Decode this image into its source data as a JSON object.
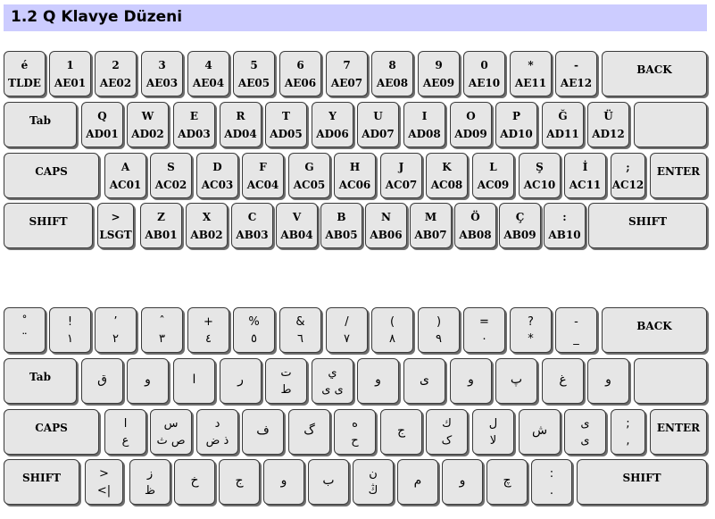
{
  "title": "1.2 Q Klavye Düzeni",
  "keyboards": [
    {
      "rows": [
        [
          [
            "é",
            "TLDE"
          ],
          [
            "1",
            "AE01"
          ],
          [
            "2",
            "AE02"
          ],
          [
            "3",
            "AE03"
          ],
          [
            "4",
            "AE04"
          ],
          [
            "5",
            "AE05"
          ],
          [
            "6",
            "AE06"
          ],
          [
            "7",
            "AE07"
          ],
          [
            "8",
            "AE08"
          ],
          [
            "9",
            "AE09"
          ],
          [
            "0",
            "AE10"
          ],
          [
            "*",
            "AE11"
          ],
          [
            "-",
            "AE12"
          ],
          [
            "BACK",
            ""
          ]
        ],
        [
          [
            "Tab",
            ""
          ],
          [
            "Q",
            "AD01"
          ],
          [
            "W",
            "AD02"
          ],
          [
            "E",
            "AD03"
          ],
          [
            "R",
            "AD04"
          ],
          [
            "T",
            "AD05"
          ],
          [
            "Y",
            "AD06"
          ],
          [
            "U",
            "AD07"
          ],
          [
            "I",
            "AD08"
          ],
          [
            "O",
            "AD09"
          ],
          [
            "P",
            "AD10"
          ],
          [
            "Ğ",
            "AD11"
          ],
          [
            "Ü",
            "AD12"
          ],
          [
            "",
            ""
          ]
        ],
        [
          [
            "CAPS",
            ""
          ],
          [
            "A",
            "AC01"
          ],
          [
            "S",
            "AC02"
          ],
          [
            "D",
            "AC03"
          ],
          [
            "F",
            "AC04"
          ],
          [
            "G",
            "AC05"
          ],
          [
            "H",
            "AC06"
          ],
          [
            "J",
            "AC07"
          ],
          [
            "K",
            "AC08"
          ],
          [
            "L",
            "AC09"
          ],
          [
            "Ş",
            "AC10"
          ],
          [
            "İ",
            "AC11"
          ],
          [
            ";",
            "AC12"
          ],
          [
            "ENTER",
            ""
          ]
        ],
        [
          [
            "SHIFT",
            ""
          ],
          [
            ">",
            "LSGT"
          ],
          [
            "Z",
            "AB01"
          ],
          [
            "X",
            "AB02"
          ],
          [
            "C",
            "AB03"
          ],
          [
            "V",
            "AB04"
          ],
          [
            "B",
            "AB05"
          ],
          [
            "N",
            "AB06"
          ],
          [
            "M",
            "AB07"
          ],
          [
            "Ö",
            "AB08"
          ],
          [
            "Ç",
            "AB09"
          ],
          [
            ":",
            "AB10"
          ],
          [
            "SHIFT",
            ""
          ]
        ]
      ]
    },
    {
      "rows": [
        [
          [
            "˚",
            "¨"
          ],
          [
            "!",
            "١"
          ],
          [
            "’",
            "٢"
          ],
          [
            "ˆ",
            "٣"
          ],
          [
            "+",
            "٤"
          ],
          [
            "%",
            "٥"
          ],
          [
            "&",
            "٦"
          ],
          [
            "/",
            "٧"
          ],
          [
            "(",
            "٨"
          ],
          [
            ")",
            "٩"
          ],
          [
            "=",
            "٠"
          ],
          [
            "?",
            "*"
          ],
          [
            "-",
            "_"
          ],
          [
            "BACK",
            ""
          ]
        ],
        [
          [
            "Tab",
            ""
          ],
          [
            "ق",
            ""
          ],
          [
            "و",
            ""
          ],
          [
            "ا",
            ""
          ],
          [
            "ر",
            ""
          ],
          [
            "ت",
            "ط"
          ],
          [
            "ي",
            "ى ى"
          ],
          [
            "و",
            ""
          ],
          [
            "ى",
            ""
          ],
          [
            "و",
            ""
          ],
          [
            "پ",
            ""
          ],
          [
            "غ",
            ""
          ],
          [
            "و",
            ""
          ],
          [
            "",
            ""
          ]
        ],
        [
          [
            "CAPS",
            ""
          ],
          [
            "ا",
            "ع"
          ],
          [
            "س",
            "ص ث"
          ],
          [
            "د",
            "ذ ض"
          ],
          [
            "ف",
            ""
          ],
          [
            "گ",
            ""
          ],
          [
            "ه",
            "ح"
          ],
          [
            "ج",
            ""
          ],
          [
            "ك",
            "ک"
          ],
          [
            "ل",
            "لا"
          ],
          [
            "ش",
            ""
          ],
          [
            "ى",
            "ى"
          ],
          [
            ";",
            ","
          ],
          [
            "ENTER",
            ""
          ]
        ],
        [
          [
            "SHIFT",
            ""
          ],
          [
            ">",
            "<|"
          ],
          [
            "ز",
            "ظ"
          ],
          [
            "خ",
            ""
          ],
          [
            "ج",
            ""
          ],
          [
            "و",
            ""
          ],
          [
            "ب",
            ""
          ],
          [
            "ن",
            "ڭ"
          ],
          [
            "م",
            ""
          ],
          [
            "و",
            ""
          ],
          [
            "چ",
            ""
          ],
          [
            ":",
            "."
          ],
          [
            "SHIFT",
            ""
          ]
        ]
      ]
    }
  ]
}
